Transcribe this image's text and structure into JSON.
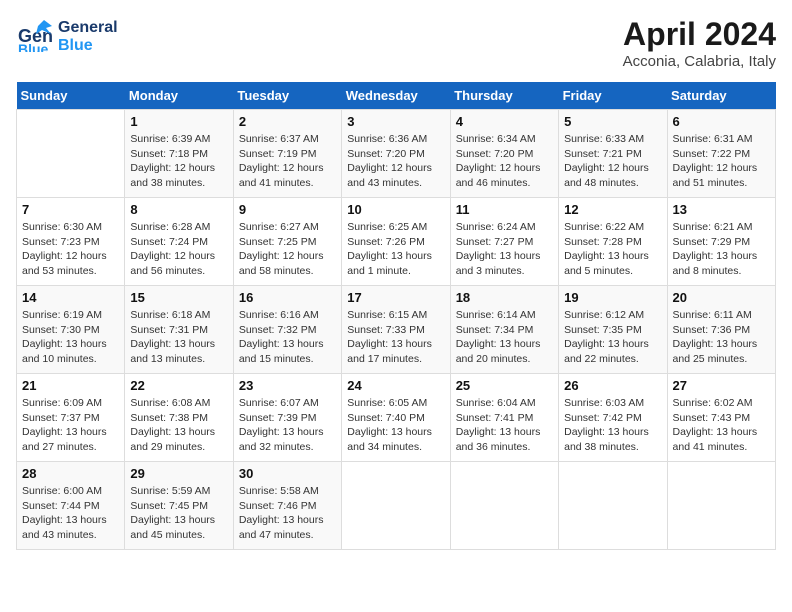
{
  "logo": {
    "line1": "General",
    "line2": "Blue"
  },
  "title": "April 2024",
  "subtitle": "Acconia, Calabria, Italy",
  "days_header": [
    "Sunday",
    "Monday",
    "Tuesday",
    "Wednesday",
    "Thursday",
    "Friday",
    "Saturday"
  ],
  "weeks": [
    [
      {
        "num": "",
        "info": ""
      },
      {
        "num": "1",
        "info": "Sunrise: 6:39 AM\nSunset: 7:18 PM\nDaylight: 12 hours\nand 38 minutes."
      },
      {
        "num": "2",
        "info": "Sunrise: 6:37 AM\nSunset: 7:19 PM\nDaylight: 12 hours\nand 41 minutes."
      },
      {
        "num": "3",
        "info": "Sunrise: 6:36 AM\nSunset: 7:20 PM\nDaylight: 12 hours\nand 43 minutes."
      },
      {
        "num": "4",
        "info": "Sunrise: 6:34 AM\nSunset: 7:20 PM\nDaylight: 12 hours\nand 46 minutes."
      },
      {
        "num": "5",
        "info": "Sunrise: 6:33 AM\nSunset: 7:21 PM\nDaylight: 12 hours\nand 48 minutes."
      },
      {
        "num": "6",
        "info": "Sunrise: 6:31 AM\nSunset: 7:22 PM\nDaylight: 12 hours\nand 51 minutes."
      }
    ],
    [
      {
        "num": "7",
        "info": "Sunrise: 6:30 AM\nSunset: 7:23 PM\nDaylight: 12 hours\nand 53 minutes."
      },
      {
        "num": "8",
        "info": "Sunrise: 6:28 AM\nSunset: 7:24 PM\nDaylight: 12 hours\nand 56 minutes."
      },
      {
        "num": "9",
        "info": "Sunrise: 6:27 AM\nSunset: 7:25 PM\nDaylight: 12 hours\nand 58 minutes."
      },
      {
        "num": "10",
        "info": "Sunrise: 6:25 AM\nSunset: 7:26 PM\nDaylight: 13 hours\nand 1 minute."
      },
      {
        "num": "11",
        "info": "Sunrise: 6:24 AM\nSunset: 7:27 PM\nDaylight: 13 hours\nand 3 minutes."
      },
      {
        "num": "12",
        "info": "Sunrise: 6:22 AM\nSunset: 7:28 PM\nDaylight: 13 hours\nand 5 minutes."
      },
      {
        "num": "13",
        "info": "Sunrise: 6:21 AM\nSunset: 7:29 PM\nDaylight: 13 hours\nand 8 minutes."
      }
    ],
    [
      {
        "num": "14",
        "info": "Sunrise: 6:19 AM\nSunset: 7:30 PM\nDaylight: 13 hours\nand 10 minutes."
      },
      {
        "num": "15",
        "info": "Sunrise: 6:18 AM\nSunset: 7:31 PM\nDaylight: 13 hours\nand 13 minutes."
      },
      {
        "num": "16",
        "info": "Sunrise: 6:16 AM\nSunset: 7:32 PM\nDaylight: 13 hours\nand 15 minutes."
      },
      {
        "num": "17",
        "info": "Sunrise: 6:15 AM\nSunset: 7:33 PM\nDaylight: 13 hours\nand 17 minutes."
      },
      {
        "num": "18",
        "info": "Sunrise: 6:14 AM\nSunset: 7:34 PM\nDaylight: 13 hours\nand 20 minutes."
      },
      {
        "num": "19",
        "info": "Sunrise: 6:12 AM\nSunset: 7:35 PM\nDaylight: 13 hours\nand 22 minutes."
      },
      {
        "num": "20",
        "info": "Sunrise: 6:11 AM\nSunset: 7:36 PM\nDaylight: 13 hours\nand 25 minutes."
      }
    ],
    [
      {
        "num": "21",
        "info": "Sunrise: 6:09 AM\nSunset: 7:37 PM\nDaylight: 13 hours\nand 27 minutes."
      },
      {
        "num": "22",
        "info": "Sunrise: 6:08 AM\nSunset: 7:38 PM\nDaylight: 13 hours\nand 29 minutes."
      },
      {
        "num": "23",
        "info": "Sunrise: 6:07 AM\nSunset: 7:39 PM\nDaylight: 13 hours\nand 32 minutes."
      },
      {
        "num": "24",
        "info": "Sunrise: 6:05 AM\nSunset: 7:40 PM\nDaylight: 13 hours\nand 34 minutes."
      },
      {
        "num": "25",
        "info": "Sunrise: 6:04 AM\nSunset: 7:41 PM\nDaylight: 13 hours\nand 36 minutes."
      },
      {
        "num": "26",
        "info": "Sunrise: 6:03 AM\nSunset: 7:42 PM\nDaylight: 13 hours\nand 38 minutes."
      },
      {
        "num": "27",
        "info": "Sunrise: 6:02 AM\nSunset: 7:43 PM\nDaylight: 13 hours\nand 41 minutes."
      }
    ],
    [
      {
        "num": "28",
        "info": "Sunrise: 6:00 AM\nSunset: 7:44 PM\nDaylight: 13 hours\nand 43 minutes."
      },
      {
        "num": "29",
        "info": "Sunrise: 5:59 AM\nSunset: 7:45 PM\nDaylight: 13 hours\nand 45 minutes."
      },
      {
        "num": "30",
        "info": "Sunrise: 5:58 AM\nSunset: 7:46 PM\nDaylight: 13 hours\nand 47 minutes."
      },
      {
        "num": "",
        "info": ""
      },
      {
        "num": "",
        "info": ""
      },
      {
        "num": "",
        "info": ""
      },
      {
        "num": "",
        "info": ""
      }
    ]
  ]
}
